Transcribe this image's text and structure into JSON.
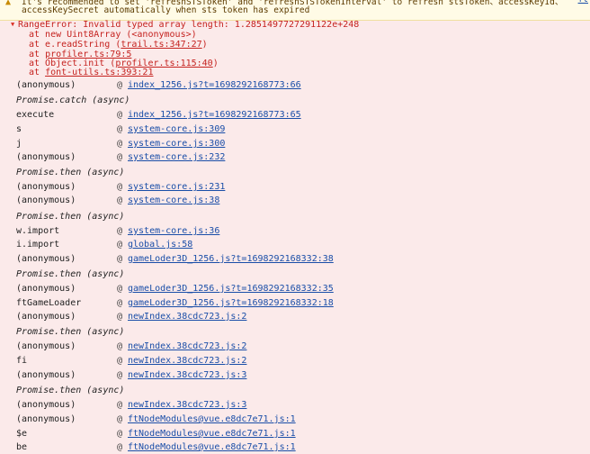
{
  "warning": {
    "line1": "It's recommended to set 'refreshSTSToken' and 'refreshSTSTokenInterval' to refresh stsToken、accessKeyId、",
    "line2": "accessKeySecret automatically when sts token has expired",
    "link": "ft"
  },
  "error": {
    "message": "RangeError: Invalid typed array length: 1.2851497727291122e+248",
    "frames": [
      {
        "prefix": "at new Uint8Array (",
        "link": "",
        "suffix": "<anonymous>)"
      },
      {
        "prefix": "at e.readString (",
        "link": "trail.ts:347:27",
        "suffix": ")"
      },
      {
        "prefix": "at ",
        "link": "profiler.ts:79:5",
        "suffix": ""
      },
      {
        "prefix": "at Object.init (",
        "link": "profiler.ts:115:40",
        "suffix": ")"
      },
      {
        "prefix": "at ",
        "link": "font-utils.ts:393:21",
        "suffix": ""
      }
    ]
  },
  "stack": [
    {
      "type": "frame",
      "fn": "(anonymous)",
      "src": "index_1256.js?t=1698292168773:66"
    },
    {
      "type": "async",
      "label": "Promise.catch (async)"
    },
    {
      "type": "frame",
      "fn": "execute",
      "src": "index_1256.js?t=1698292168773:65"
    },
    {
      "type": "frame",
      "fn": "s",
      "src": "system-core.js:309"
    },
    {
      "type": "frame",
      "fn": "j",
      "src": "system-core.js:300"
    },
    {
      "type": "frame",
      "fn": "(anonymous)",
      "src": "system-core.js:232"
    },
    {
      "type": "async",
      "label": "Promise.then (async)"
    },
    {
      "type": "frame",
      "fn": "(anonymous)",
      "src": "system-core.js:231"
    },
    {
      "type": "frame",
      "fn": "(anonymous)",
      "src": "system-core.js:38"
    },
    {
      "type": "async",
      "label": "Promise.then (async)"
    },
    {
      "type": "frame",
      "fn": "w.import",
      "src": "system-core.js:36"
    },
    {
      "type": "frame",
      "fn": "i.import",
      "src": "global.js:58"
    },
    {
      "type": "frame",
      "fn": "(anonymous)",
      "src": "gameLoder3D_1256.js?t=1698292168332:38"
    },
    {
      "type": "async",
      "label": "Promise.then (async)"
    },
    {
      "type": "frame",
      "fn": "(anonymous)",
      "src": "gameLoder3D_1256.js?t=1698292168332:35"
    },
    {
      "type": "frame",
      "fn": "ftGameLoader",
      "src": "gameLoder3D_1256.js?t=1698292168332:18"
    },
    {
      "type": "frame",
      "fn": "(anonymous)",
      "src": "newIndex.38cdc723.js:2"
    },
    {
      "type": "async",
      "label": "Promise.then (async)"
    },
    {
      "type": "frame",
      "fn": "(anonymous)",
      "src": "newIndex.38cdc723.js:2"
    },
    {
      "type": "frame",
      "fn": "fi",
      "src": "newIndex.38cdc723.js:2"
    },
    {
      "type": "frame",
      "fn": "(anonymous)",
      "src": "newIndex.38cdc723.js:3"
    },
    {
      "type": "async",
      "label": "Promise.then (async)"
    },
    {
      "type": "frame",
      "fn": "(anonymous)",
      "src": "newIndex.38cdc723.js:3"
    },
    {
      "type": "frame",
      "fn": "(anonymous)",
      "src": "ftNodeModules@vue.e8dc7e71.js:1"
    },
    {
      "type": "frame",
      "fn": "$e",
      "src": "ftNodeModules@vue.e8dc7e71.js:1"
    },
    {
      "type": "frame",
      "fn": "be",
      "src": "ftNodeModules@vue.e8dc7e71.js:1"
    }
  ],
  "at_symbol": "@"
}
